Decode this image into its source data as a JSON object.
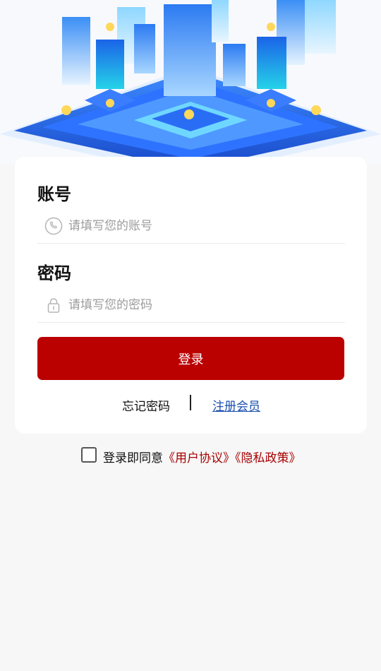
{
  "account": {
    "label": "账号",
    "placeholder": "请填写您的账号",
    "icon": "phone-icon"
  },
  "password": {
    "label": "密码",
    "placeholder": "请填写您的密码",
    "icon": "lock-icon"
  },
  "login_button": "登录",
  "forgot_password": "忘记密码",
  "register": "注册会员",
  "agreement": {
    "prefix": "登录即同意",
    "user_agreement": "《用户协议》",
    "privacy_policy": "《隐私政策》",
    "checked": false
  },
  "colors": {
    "primary": "#bb0000",
    "link_blue": "#1a4fb0",
    "link_red": "#a80000",
    "background": "#f7f7f7",
    "card": "#ffffff"
  }
}
